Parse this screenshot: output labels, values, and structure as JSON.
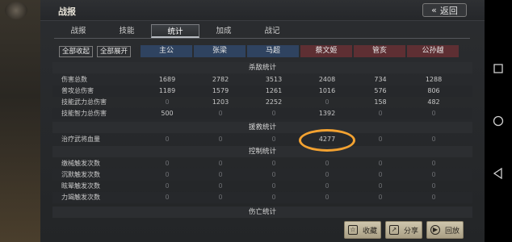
{
  "header": {
    "title": "战报",
    "back_label": "返回"
  },
  "tabs": [
    {
      "label": "战报"
    },
    {
      "label": "技能"
    },
    {
      "label": "统计"
    },
    {
      "label": "加成"
    },
    {
      "label": "战记"
    }
  ],
  "active_tab": "统计",
  "controls": {
    "collapse_all": "全部收起",
    "expand_all": "全部展开"
  },
  "generals": [
    {
      "name": "主公",
      "side": "blue"
    },
    {
      "name": "张梁",
      "side": "blue"
    },
    {
      "name": "马超",
      "side": "blue"
    },
    {
      "name": "蔡文姬",
      "side": "red"
    },
    {
      "name": "管亥",
      "side": "red"
    },
    {
      "name": "公孙越",
      "side": "red"
    }
  ],
  "sections": {
    "kill": "杀敌统计",
    "rescue": "援救统计",
    "control": "控制统计",
    "death": "伤亡统计"
  },
  "rows": {
    "total_damage": {
      "label": "伤害总数",
      "values": [
        "1689",
        "2782",
        "3513",
        "2408",
        "734",
        "1288"
      ]
    },
    "normal_attack": {
      "label": "普攻总伤害",
      "values": [
        "1189",
        "1579",
        "1261",
        "1016",
        "576",
        "806"
      ]
    },
    "skill_force": {
      "label": "技能武力总伤害",
      "values": [
        "0",
        "1203",
        "2252",
        "0",
        "158",
        "482"
      ]
    },
    "skill_intel": {
      "label": "技能智力总伤害",
      "values": [
        "500",
        "0",
        "0",
        "1392",
        "0",
        "0"
      ]
    },
    "heal": {
      "label": "治疗武将血量",
      "values": [
        "0",
        "0",
        "0",
        "4277",
        "0",
        "0"
      ]
    },
    "disarm": {
      "label": "缴械触发次数",
      "values": [
        "0",
        "0",
        "0",
        "0",
        "0",
        "0"
      ]
    },
    "silence": {
      "label": "沉默触发次数",
      "values": [
        "0",
        "0",
        "0",
        "0",
        "0",
        "0"
      ]
    },
    "stun": {
      "label": "眩晕触发次数",
      "values": [
        "0",
        "0",
        "0",
        "0",
        "0",
        "0"
      ]
    },
    "exhaust": {
      "label": "力竭触发次数",
      "values": [
        "0",
        "0",
        "0",
        "0",
        "0",
        "0"
      ]
    }
  },
  "bottom_buttons": {
    "favorite": "收藏",
    "share": "分享",
    "replay": "回放"
  },
  "colors": {
    "annotation": "#f3a231",
    "team_blue": "#2f4360",
    "team_red": "#5e2f33"
  }
}
